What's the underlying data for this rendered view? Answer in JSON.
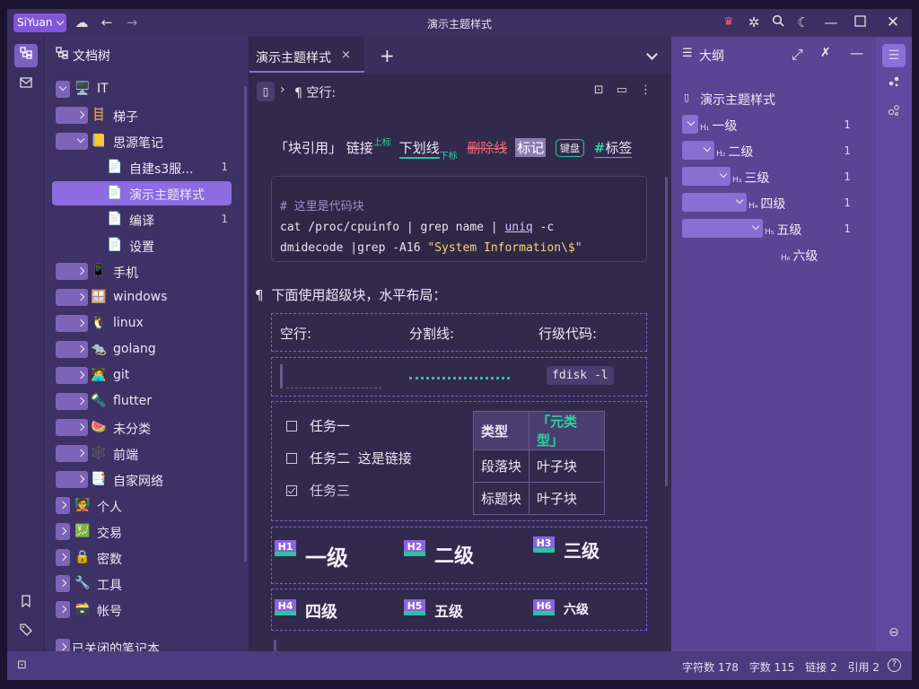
{
  "titlebar": {
    "brand": "SiYuan",
    "title": "演示主题样式",
    "icons": [
      "cloud-sync-icon",
      "back-icon",
      "forward-icon",
      "crown-icon",
      "plugin-icon",
      "search-icon",
      "dark-mode-icon",
      "minimize-icon",
      "maximize-icon",
      "close-icon"
    ]
  },
  "dock_left": {
    "top_icons": [
      "filetree-icon",
      "inbox-icon"
    ],
    "bottom_icons": [
      "bookmark-icon",
      "tag-icon"
    ]
  },
  "filetree": {
    "title": "文档树",
    "items": [
      {
        "label": "IT",
        "emoji": "🖥️",
        "depth": 0,
        "expanded": true,
        "count": ""
      },
      {
        "label": "梯子",
        "emoji": "🪜",
        "depth": 1,
        "expanded": false,
        "count": ""
      },
      {
        "label": "思源笔记",
        "emoji": "📒",
        "depth": 1,
        "expanded": true,
        "count": ""
      },
      {
        "label": "自建s3服...",
        "emoji": "📄",
        "depth": 2,
        "count": "1"
      },
      {
        "label": "演示主题样式",
        "emoji": "📄",
        "depth": 2,
        "count": "",
        "selected": true
      },
      {
        "label": "编译",
        "emoji": "📄",
        "depth": 2,
        "count": "1"
      },
      {
        "label": "设置",
        "emoji": "📄",
        "depth": 2,
        "count": ""
      },
      {
        "label": "手机",
        "emoji": "📱",
        "depth": 1,
        "expanded": false,
        "count": ""
      },
      {
        "label": "windows",
        "emoji": "🪟",
        "depth": 1,
        "expanded": false,
        "count": ""
      },
      {
        "label": "linux",
        "emoji": "🐧",
        "depth": 1,
        "expanded": false,
        "count": ""
      },
      {
        "label": "golang",
        "emoji": "🐀",
        "depth": 1,
        "expanded": false,
        "count": ""
      },
      {
        "label": "git",
        "emoji": "🧑‍💻",
        "depth": 1,
        "expanded": false,
        "count": ""
      },
      {
        "label": "flutter",
        "emoji": "🔦",
        "depth": 1,
        "expanded": false,
        "count": ""
      },
      {
        "label": "未分类",
        "emoji": "🍉",
        "depth": 1,
        "expanded": false,
        "count": ""
      },
      {
        "label": "前端",
        "emoji": "🕸️",
        "depth": 1,
        "expanded": false,
        "count": ""
      },
      {
        "label": "自家网络",
        "emoji": "📑",
        "depth": 1,
        "expanded": false,
        "count": ""
      },
      {
        "label": "个人",
        "emoji": "🧑‍🏫",
        "depth": 0,
        "expanded": false,
        "count": ""
      },
      {
        "label": "交易",
        "emoji": "💹",
        "depth": 0,
        "expanded": false,
        "count": ""
      },
      {
        "label": "密数",
        "emoji": "🔒",
        "depth": 0,
        "expanded": false,
        "count": ""
      },
      {
        "label": "工具",
        "emoji": "🔧",
        "depth": 0,
        "expanded": false,
        "count": ""
      },
      {
        "label": "帐号",
        "emoji": "🗃️",
        "depth": 0,
        "expanded": false,
        "count": ""
      }
    ],
    "closed_notebooks": "已关闭的笔记本"
  },
  "editor": {
    "tab_label": "演示主题样式",
    "tab_close": "×",
    "tab_add": "+",
    "breadcrumb_text": "空行:",
    "breadcrumb_para": "¶",
    "inline": {
      "quote": "「块引用」",
      "link": "链接",
      "sup": "上标",
      "underline": "下划线",
      "sub": "下标",
      "strike": "删除线",
      "mark": "标记",
      "kbd": "键盘",
      "tag_hash": "#",
      "tag": "标签"
    },
    "code_lines": [
      {
        "kind": "comment",
        "text": "# 这里是代码块"
      },
      {
        "kind": "cmd1",
        "a": "cat /proc/cpuinfo | grep name | ",
        "b": "uniq",
        "c": " -c"
      },
      {
        "kind": "cmd2",
        "a": "dmidecode |grep -A16 ",
        "b": "\"System Information\\$\""
      }
    ],
    "para_mark": "¶",
    "para_text": "下面使用超级块，水平布局：",
    "sb1": [
      "空行:",
      "分割线:",
      "行级代码:"
    ],
    "inline_code": "fdisk -l",
    "tasks": [
      {
        "label": "任务一",
        "checked": false,
        "link": ""
      },
      {
        "label": "任务二",
        "checked": false,
        "link": "这是链接"
      },
      {
        "label": "任务三",
        "checked": true,
        "link": ""
      }
    ],
    "table": {
      "headers": [
        "类型",
        "「元类型」"
      ],
      "rows": [
        [
          "段落块",
          "叶子块"
        ],
        [
          "标题块",
          "叶子块"
        ]
      ]
    },
    "headings": [
      {
        "badge": "H1",
        "text": "一级"
      },
      {
        "badge": "H2",
        "text": "二级"
      },
      {
        "badge": "H3",
        "text": "三级"
      },
      {
        "badge": "H4",
        "text": "四级"
      },
      {
        "badge": "H5",
        "text": "五级"
      },
      {
        "badge": "H6",
        "text": "六级"
      }
    ]
  },
  "outline": {
    "title": "大纲",
    "doc": "演示主题样式",
    "items": [
      {
        "h": "H₁",
        "label": "一级",
        "count": "1"
      },
      {
        "h": "H₂",
        "label": "二级",
        "count": "1"
      },
      {
        "h": "H₃",
        "label": "三级",
        "count": "1"
      },
      {
        "h": "H₄",
        "label": "四级",
        "count": "1"
      },
      {
        "h": "H₅",
        "label": "五级",
        "count": "1"
      },
      {
        "h": "H₆",
        "label": "六级",
        "count": ""
      }
    ]
  },
  "statusbar": {
    "chars": "字符数 178",
    "words": "字数 115",
    "links": "链接 2",
    "refs": "引用 2",
    "help": "?"
  }
}
